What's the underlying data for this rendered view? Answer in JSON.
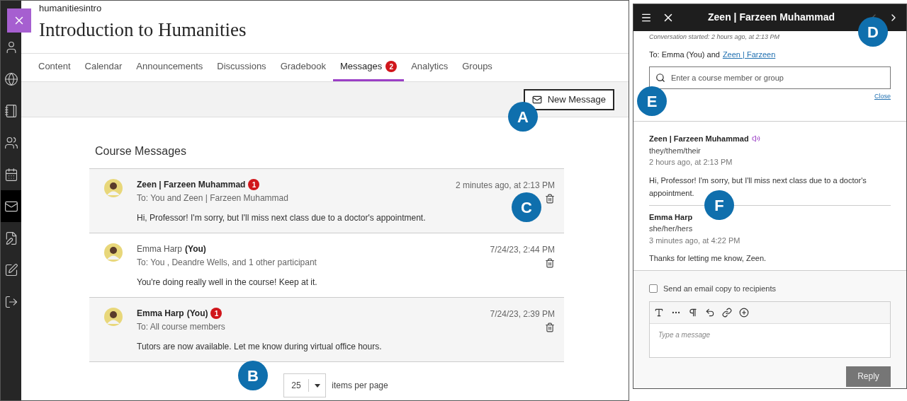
{
  "nav_rail": [
    {
      "kind": "user",
      "selected": false
    },
    {
      "kind": "globe",
      "selected": false
    },
    {
      "kind": "book",
      "selected": false
    },
    {
      "kind": "people",
      "selected": false
    },
    {
      "kind": "calendar",
      "selected": false
    },
    {
      "kind": "mail",
      "selected": true
    },
    {
      "kind": "document",
      "selected": false
    },
    {
      "kind": "edit",
      "selected": false
    },
    {
      "kind": "signout",
      "selected": false
    }
  ],
  "course": {
    "code": "humanitiesintro",
    "title": "Introduction to Humanities"
  },
  "tabs": [
    {
      "label": "Content",
      "selected": false
    },
    {
      "label": "Calendar",
      "selected": false
    },
    {
      "label": "Announcements",
      "selected": false
    },
    {
      "label": "Discussions",
      "selected": false
    },
    {
      "label": "Gradebook",
      "selected": false
    },
    {
      "label": "Messages",
      "selected": true,
      "badge": "2"
    },
    {
      "label": "Analytics",
      "selected": false
    },
    {
      "label": "Groups",
      "selected": false
    }
  ],
  "new_message_button": "New Message",
  "section_title": "Course Messages",
  "messages": [
    {
      "sender": "Zeen | Farzeen Muhammad",
      "unread": true,
      "badge": "1",
      "to": "To: You and Zeen | Farzeen Muhammad",
      "body": "Hi, Professor! I'm sorry, but I'll miss next class due to a doctor's appointment.",
      "time": "2 minutes ago, at 2:13 PM"
    },
    {
      "sender": "Emma Harp",
      "you_label": "(You)",
      "unread": false,
      "to": "To: You , Deandre Wells, and 1 other participant",
      "body": "You're doing really well in the course! Keep at it.",
      "time": "7/24/23, 2:44 PM"
    },
    {
      "sender": "Emma Harp",
      "you_label": "(You)",
      "unread": true,
      "badge": "1",
      "to": "To: All course members",
      "body": "Tutors are now available. Let me know during virtual office hours.",
      "time": "7/24/23, 2:39 PM"
    }
  ],
  "pagination": {
    "page_size": "25",
    "label": "items per page"
  },
  "panel": {
    "title": "Zeen | Farzeen Muhammad",
    "conversation_started": "Conversation started: 2 hours ago, at 2:13 PM",
    "to_prefix": "To: Emma (You) and",
    "to_link": "Zeen | Farzeen",
    "search_placeholder": "Enter a course member or group",
    "close_link": "Close",
    "thread": [
      {
        "name": "Zeen | Farzeen Muhammad",
        "audio": true,
        "pronouns": "they/them/their",
        "time": "2 hours ago, at 2:13 PM",
        "body": "Hi, Professor! I'm sorry, but I'll miss next class due to a doctor's appointment."
      },
      {
        "name": "Emma Harp",
        "audio": false,
        "pronouns": "she/her/hers",
        "time": "3 minutes ago, at 4:22 PM",
        "body": "Thanks for letting me know, Zeen."
      }
    ],
    "email_copy": {
      "label": "Send an email copy to recipients",
      "checked": false
    },
    "editor_placeholder": "Type a message",
    "reply_button": {
      "label": "Reply",
      "disabled": true
    }
  },
  "callouts": [
    "A",
    "B",
    "C",
    "D",
    "E",
    "F"
  ]
}
